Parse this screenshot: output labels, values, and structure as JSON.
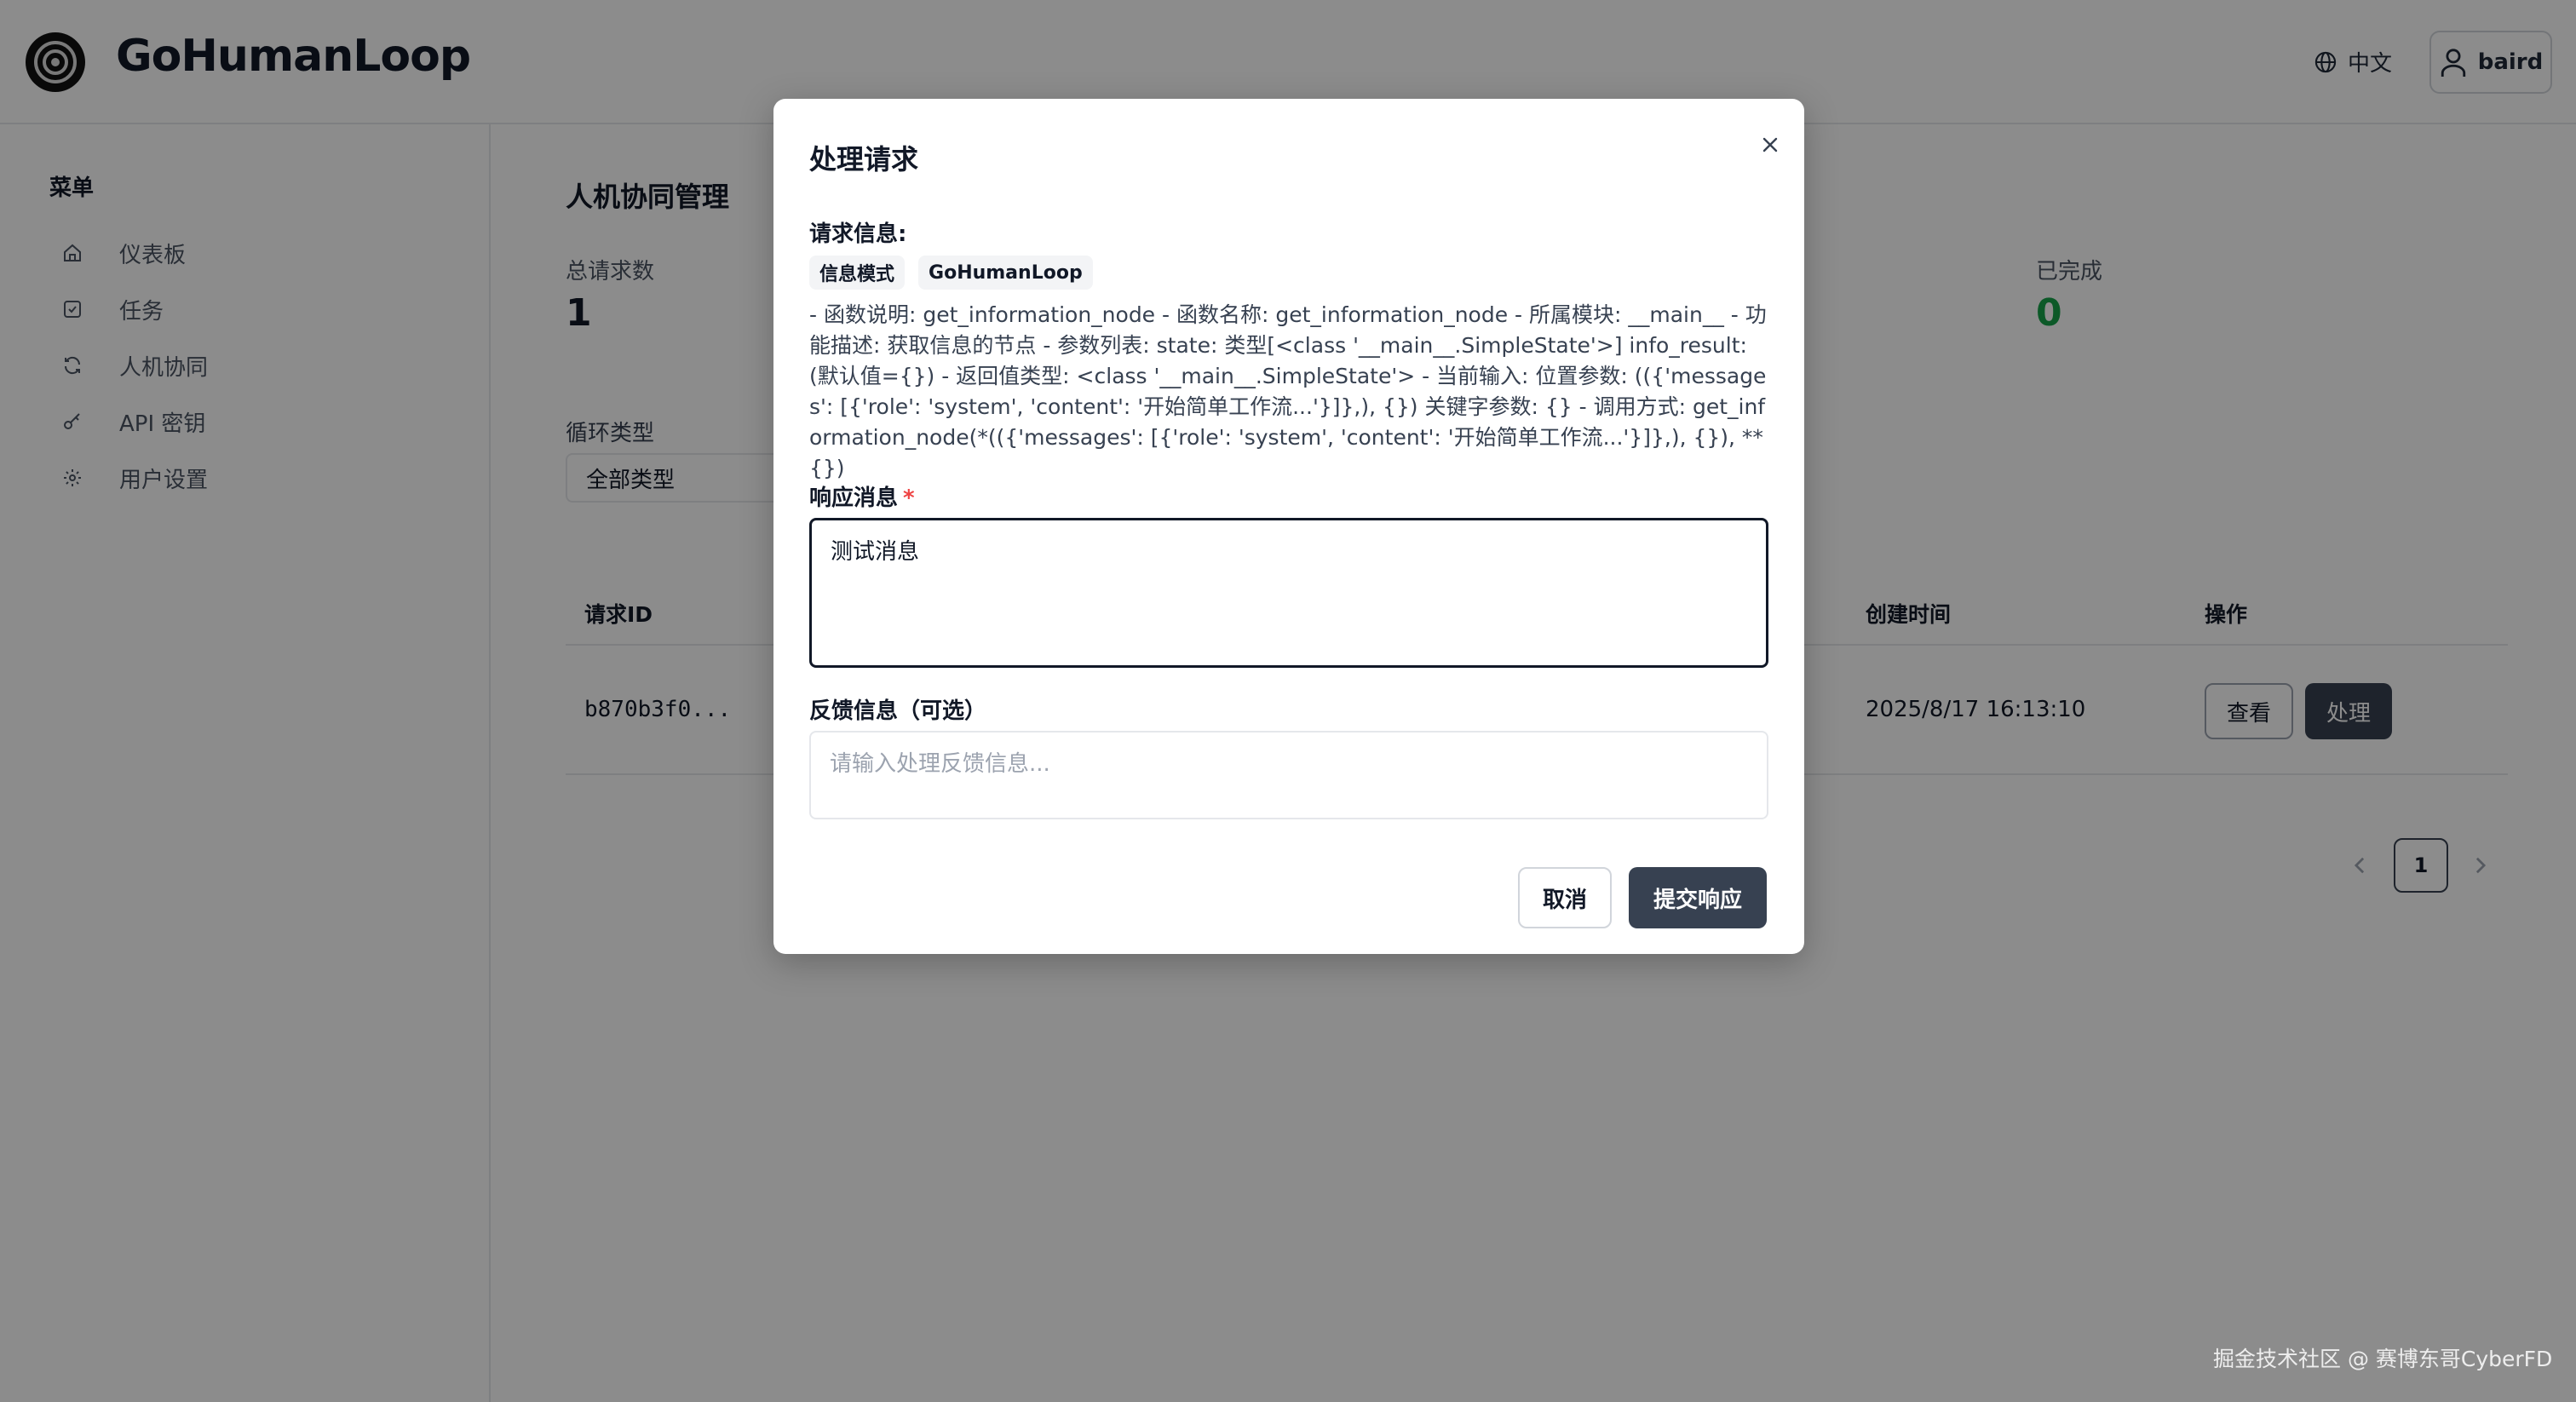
{
  "header": {
    "brand": "GoHumanLoop",
    "language": "中文",
    "username": "baird"
  },
  "sidebar": {
    "title": "菜单",
    "items": [
      {
        "label": "仪表板",
        "icon": "home-icon"
      },
      {
        "label": "任务",
        "icon": "checkbox-icon"
      },
      {
        "label": "人机协同",
        "icon": "refresh-icon"
      },
      {
        "label": "API 密钥",
        "icon": "key-icon"
      },
      {
        "label": "用户设置",
        "icon": "gear-icon"
      }
    ]
  },
  "main": {
    "title": "人机协同管理",
    "stats": {
      "total_label": "总请求数",
      "total_value": "1",
      "completed_label": "已完成",
      "completed_value": "0"
    },
    "filter": {
      "label": "循环类型",
      "value": "全部类型"
    },
    "table": {
      "headers": {
        "id": "请求ID",
        "created": "创建时间",
        "actions": "操作"
      },
      "rows": [
        {
          "id": "b870b3f0...",
          "created": "2025/8/17 16:13:10",
          "view_label": "查看",
          "handle_label": "处理"
        }
      ]
    },
    "pagination": {
      "current": "1"
    }
  },
  "modal": {
    "title": "处理请求",
    "info_label": "请求信息:",
    "tags": [
      "信息模式",
      "GoHumanLoop"
    ],
    "description": "- 函数说明: get_information_node - 函数名称: get_information_node - 所属模块: __main__ - 功能描述: 获取信息的节点 - 参数列表: state: 类型[<class '__main__.SimpleState'>] info_result: (默认值={}) - 返回值类型: <class '__main__.SimpleState'> - 当前输入: 位置参数: (({'messages': [{'role': 'system', 'content': '开始简单工作流...'}]},), {}) 关键字参数: {} - 调用方式: get_information_node(*(({'messages': [{'role': 'system', 'content': '开始简单工作流...'}]},), {}), **{})",
    "response_label": "响应消息",
    "required_mark": "*",
    "response_value": "测试消息",
    "feedback_label": "反馈信息（可选）",
    "feedback_placeholder": "请输入处理反馈信息...",
    "cancel_label": "取消",
    "submit_label": "提交响应"
  },
  "watermark": "掘金技术社区 @ 赛博东哥CyberFD",
  "colors": {
    "primary": "#374151",
    "success": "#16a34a",
    "required": "#ef4444"
  }
}
